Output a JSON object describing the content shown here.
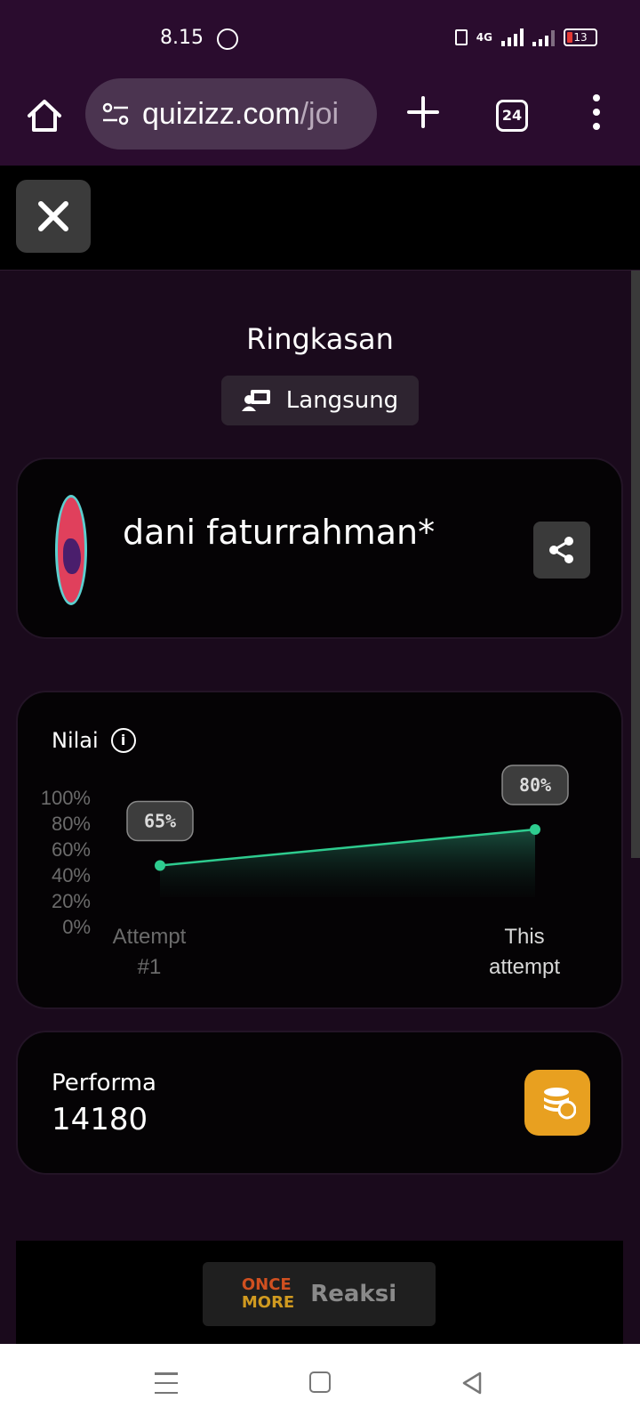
{
  "status_bar": {
    "time": "8.15",
    "network": "4G",
    "battery": "13"
  },
  "browser": {
    "url_main": "quizizz.com",
    "url_rest": "/joi",
    "tab_count": "24"
  },
  "page": {
    "title": "Ringkasan",
    "mode_label": "Langsung"
  },
  "user": {
    "name": "dani faturrahman*"
  },
  "score": {
    "label": "Nilai"
  },
  "chart_data": {
    "type": "area",
    "categories": [
      "Attempt #1",
      "This attempt"
    ],
    "category_lines": [
      [
        "Attempt",
        "#1"
      ],
      [
        "This",
        "attempt"
      ]
    ],
    "values": [
      65,
      80
    ],
    "value_labels": [
      "65%",
      "80%"
    ],
    "y_ticks": [
      "100%",
      "80%",
      "60%",
      "40%",
      "20%",
      "0%"
    ],
    "ylim": [
      0,
      100
    ],
    "line_color": "#2ecc8f",
    "grid": false
  },
  "performance": {
    "label": "Performa",
    "value": "14180"
  },
  "reactions": {
    "logo_line1": "ONCE",
    "logo_line2": "MORE",
    "label": "Reaksi"
  },
  "colors": {
    "accent": "#2ecc8f",
    "coin": "#e8a020"
  }
}
